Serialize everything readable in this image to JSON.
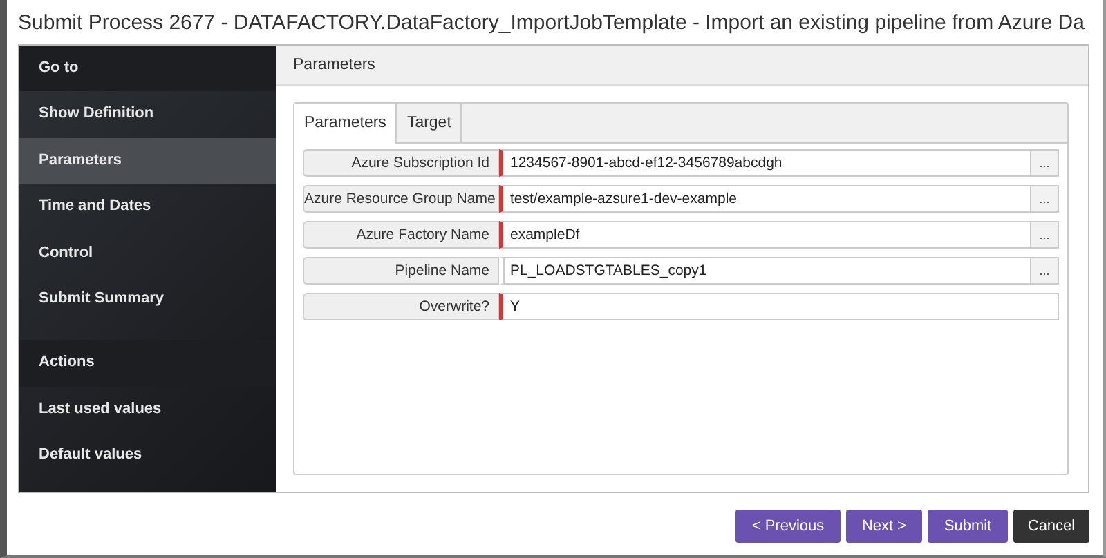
{
  "window": {
    "title": "Submit Process 2677 - DATAFACTORY.DataFactory_ImportJobTemplate - Import an existing pipeline from Azure Da"
  },
  "sidebar": {
    "items": [
      {
        "label": "Go to",
        "kind": "header"
      },
      {
        "label": "Show Definition",
        "kind": "item",
        "selected": false
      },
      {
        "label": "Parameters",
        "kind": "item",
        "selected": true
      },
      {
        "label": "Time and Dates",
        "kind": "item",
        "selected": false
      },
      {
        "label": "Control",
        "kind": "item",
        "selected": false
      },
      {
        "label": "Submit Summary",
        "kind": "item",
        "selected": false
      },
      {
        "label": "Actions",
        "kind": "header"
      },
      {
        "label": "Last used values",
        "kind": "item",
        "selected": false
      },
      {
        "label": "Default values",
        "kind": "item",
        "selected": false
      }
    ]
  },
  "panel": {
    "title": "Parameters",
    "tabs": [
      {
        "label": "Parameters",
        "selected": true
      },
      {
        "label": "Target",
        "selected": false
      }
    ],
    "fields": [
      {
        "label": "Azure Subscription Id",
        "value": "1234567-8901-abcd-ef12-3456789abcdgh",
        "required": true,
        "browse": "..."
      },
      {
        "label": "Azure Resource Group Name",
        "value": "test/example-azsure1-dev-example",
        "required": true,
        "browse": "..."
      },
      {
        "label": "Azure Factory Name",
        "value": "exampleDf",
        "required": true,
        "browse": "..."
      },
      {
        "label": "Pipeline Name",
        "value": "PL_LOADSTGTABLES_copy1",
        "required": false,
        "browse": "..."
      },
      {
        "label": "Overwrite?",
        "value": "Y",
        "required": true
      }
    ]
  },
  "buttons": [
    {
      "label": "< Previous",
      "kind": "primary"
    },
    {
      "label": "Next >",
      "kind": "primary"
    },
    {
      "label": "Submit",
      "kind": "primary"
    },
    {
      "label": "Cancel",
      "kind": "dark"
    }
  ]
}
